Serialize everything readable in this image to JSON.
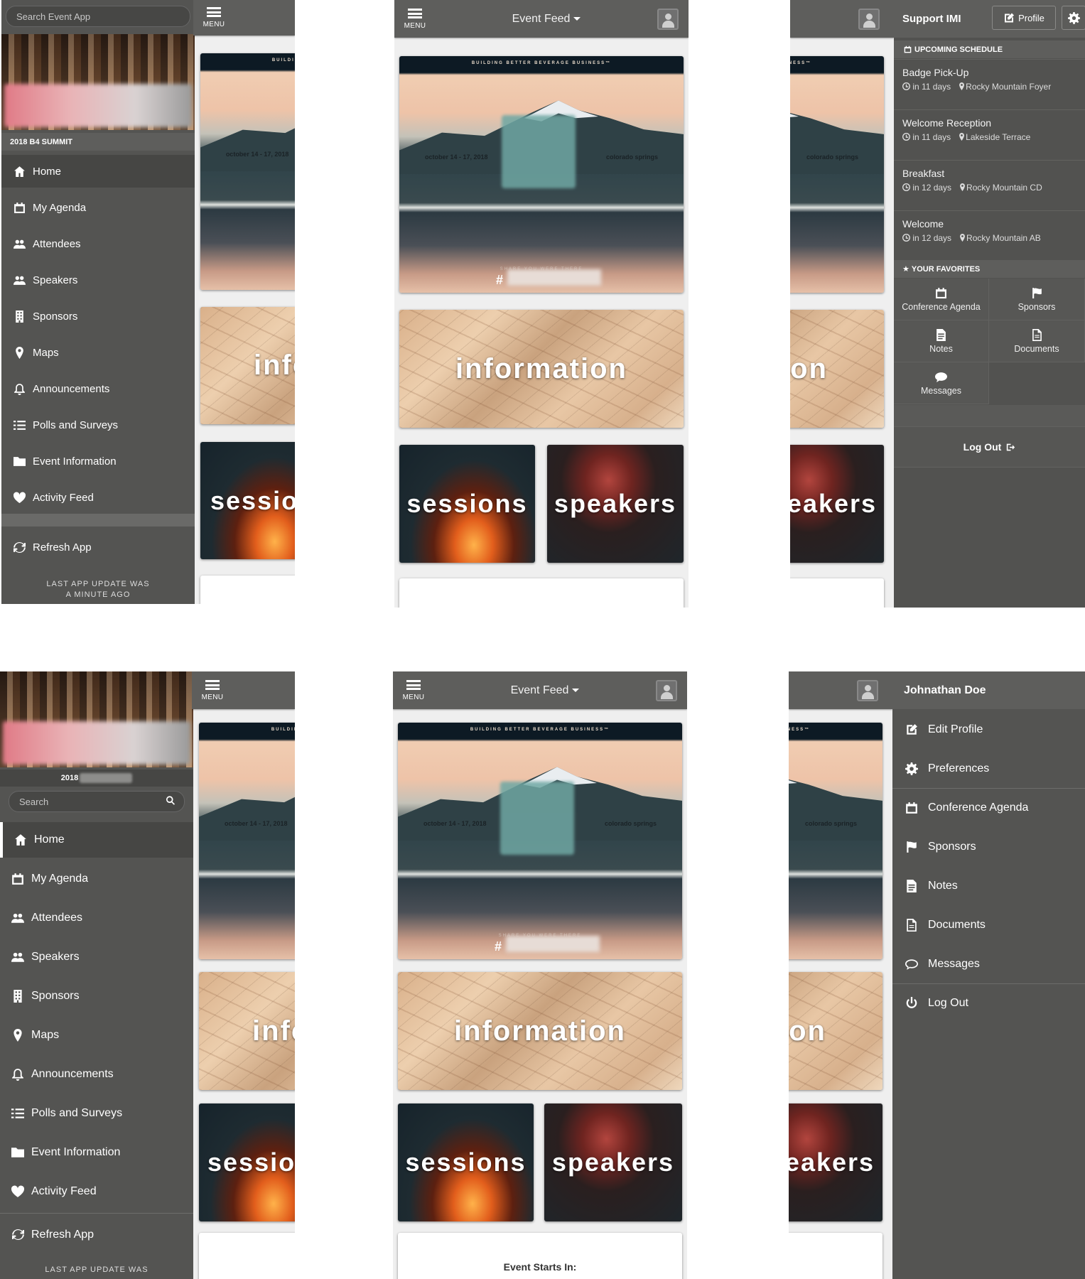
{
  "topbar": {
    "menu_label": "MENU",
    "feed_title": "Event Feed"
  },
  "hero": {
    "tagline": "BUILDING BETTER BEVERAGE BUSINESS™",
    "dates": "october 14 - 17, 2018",
    "city": "colorado springs",
    "share": "SHARE YOU WERE THERE",
    "hash": "#"
  },
  "tiles": {
    "information": "information",
    "sessions": "sessions",
    "speakers": "speakers"
  },
  "left_menu_top": {
    "search_placeholder": "Search Event App",
    "event_name": "2018 B4 SUMMIT",
    "items": [
      {
        "label": "Home",
        "icon": "home-icon"
      },
      {
        "label": "My Agenda",
        "icon": "calendar-icon"
      },
      {
        "label": "Attendees",
        "icon": "users-icon"
      },
      {
        "label": "Speakers",
        "icon": "users-icon"
      },
      {
        "label": "Sponsors",
        "icon": "building-icon"
      },
      {
        "label": "Maps",
        "icon": "map-marker-icon"
      },
      {
        "label": "Announcements",
        "icon": "bell-icon"
      },
      {
        "label": "Polls and Surveys",
        "icon": "list-icon"
      },
      {
        "label": "Event Information",
        "icon": "folder-icon"
      },
      {
        "label": "Activity Feed",
        "icon": "heart-icon"
      }
    ],
    "refresh": "Refresh App",
    "update_line1": "LAST APP UPDATE WAS",
    "update_line2": "A MINUTE AGO"
  },
  "left_menu_bottom": {
    "year": "2018",
    "search_placeholder": "Search",
    "update_line1": "LAST APP UPDATE WAS"
  },
  "right_panel_top": {
    "title": "Support IMI",
    "profile_button": "Profile",
    "schedule_header": "UPCOMING SCHEDULE",
    "schedule": [
      {
        "title": "Badge Pick-Up",
        "when": "in 11 days",
        "where": "Rocky Mountain Foyer"
      },
      {
        "title": "Welcome Reception",
        "when": "in 11 days",
        "where": "Lakeside Terrace"
      },
      {
        "title": "Breakfast",
        "when": "in 12 days",
        "where": "Rocky Mountain CD"
      },
      {
        "title": "Welcome",
        "when": "in 12 days",
        "where": "Rocky Mountain AB"
      }
    ],
    "favorites_header": "YOUR FAVORITES",
    "favorites": [
      "Conference Agenda",
      "Sponsors",
      "Notes",
      "Documents",
      "Messages"
    ],
    "logout": "Log Out"
  },
  "right_panel_bottom": {
    "user_name": "Johnathan Doe",
    "items": [
      "Edit Profile",
      "Preferences",
      "Conference Agenda",
      "Sponsors",
      "Notes",
      "Documents",
      "Messages",
      "Log Out"
    ]
  },
  "event_starts": "Event Starts In:"
}
